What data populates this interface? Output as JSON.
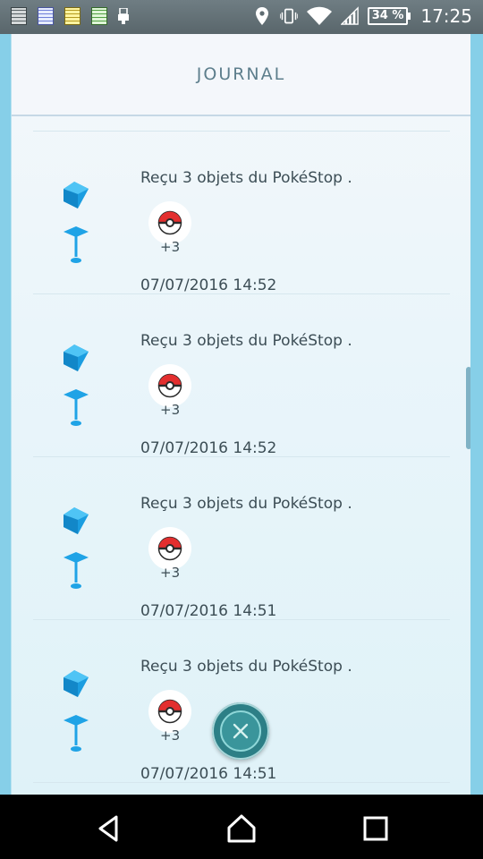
{
  "status_bar": {
    "battery": "34 %",
    "time": "17:25",
    "left_icons": [
      "notes-gray-icon",
      "notes-blue-icon",
      "notes-yellow-icon",
      "notes-green-icon",
      "usb-icon"
    ],
    "right_icons": [
      "location-icon",
      "vibrate-icon",
      "wifi-icon",
      "signal-icon"
    ]
  },
  "header": {
    "title": "JOURNAL"
  },
  "entries": [
    {
      "message": "Reçu 3 objets du PokéStop .",
      "item_count": "+3",
      "item_icon": "pokeball-icon",
      "date": "07/07/2016 14:52"
    },
    {
      "message": "Reçu 3 objets du PokéStop .",
      "item_count": "+3",
      "item_icon": "pokeball-icon",
      "date": "07/07/2016 14:52"
    },
    {
      "message": "Reçu 3 objets du PokéStop .",
      "item_count": "+3",
      "item_icon": "pokeball-icon",
      "date": "07/07/2016 14:51"
    },
    {
      "message": "Reçu 3 objets du PokéStop .",
      "item_count": "+3",
      "item_icon": "pokeball-icon",
      "date": "07/07/2016 14:51"
    }
  ],
  "colors": {
    "accent": "#3a959b",
    "text": "#3c4d55",
    "title": "#5d7e8c",
    "pokestop_blue": "#1fa3e6"
  },
  "nav": {
    "icons": [
      "back-icon",
      "home-icon",
      "recents-icon"
    ]
  }
}
